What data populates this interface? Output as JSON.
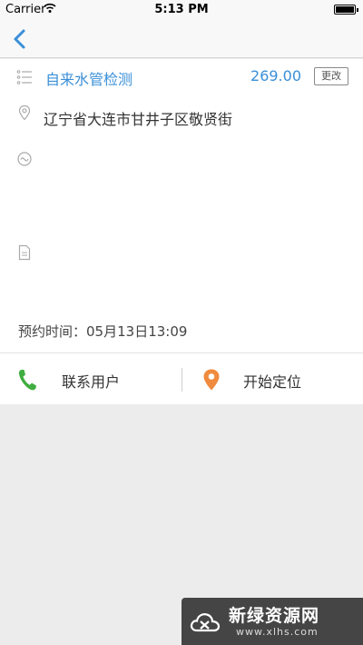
{
  "status_bar": {
    "carrier": "Carrier",
    "time": "5:13 PM"
  },
  "nav": {
    "back_icon": "chevron-left-icon",
    "accent_color": "#3a8fd8"
  },
  "order": {
    "service_name": "自来水管检测",
    "price": "269.00",
    "change_label": "更改",
    "address": "辽宁省大连市甘井子区敬贤街",
    "appointment_label": "预约时间：",
    "appointment_time": "05月13日13:09"
  },
  "actions": {
    "contact_label": "联系用户",
    "contact_icon_color": "#3fae3f",
    "locate_label": "开始定位",
    "locate_icon_color": "#f08a3e"
  },
  "watermark": {
    "title": "新绿资源网",
    "url": "www.xlhs.com"
  }
}
